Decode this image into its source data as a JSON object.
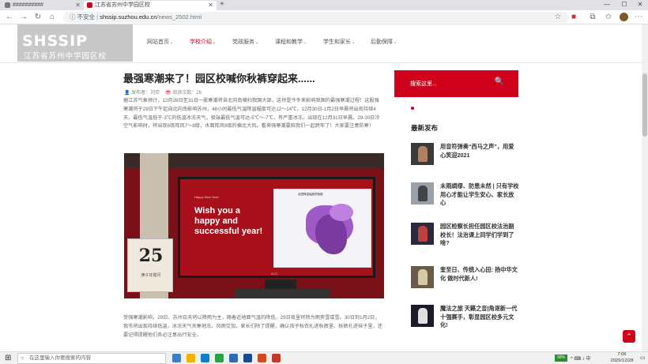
{
  "browser": {
    "tabs": [
      {
        "label": "##########"
      },
      {
        "label": "江苏省苏州中学园区校"
      }
    ],
    "new_tab": "+",
    "window_controls": {
      "minimize": "—",
      "maximize": "☐",
      "close": "✕"
    },
    "nav": {
      "back": "←",
      "forward": "→",
      "reload": "↻",
      "home": "⌂"
    },
    "address": {
      "security": "ⓘ 不安全",
      "host": "shssip.suzhou.edu.cn",
      "path": "/news_2502.html"
    },
    "toolbar_icons": {
      "star": "☆",
      "ext": "■",
      "collections": "⧉",
      "menu": "⋯"
    }
  },
  "site": {
    "logo_main": "SHSSIP",
    "logo_sub": "江苏省苏州中学园区校",
    "nav": [
      {
        "label": "网站首页",
        "chevron": "⌄"
      },
      {
        "label": "学校介绍",
        "chevron": "⌄"
      },
      {
        "label": "党政服务",
        "chevron": "⌄"
      },
      {
        "label": "课程和教学",
        "chevron": "⌄"
      },
      {
        "label": "学生和家长",
        "chevron": "⌄"
      },
      {
        "label": "后勤保障",
        "chevron": "⌄"
      }
    ]
  },
  "article": {
    "title": "最强寒潮来了！园区校喊你秋裤穿起来......",
    "author": "发布者：刘欢",
    "views": "阅读次数：26",
    "para1": "据江苏气象预计，12月28日至31日一股寒潮将自北向南横扫我国大部，这将是今冬来影响我国的最强寒潮过程！这股强寒潮将于29日下午起自北向南影响苏州，48小时最低气温降温幅度可达12～14℃，12月30日-1月2日早晨将出现持续4天、最低气温低于-3℃的低温冰冻天气，极端最低气温可达-5℃～-7℃，有严重冰冻。出现在12月31日早晨。29-30日冷空气影响时，将出现6级阵风7～8级，水面阵风9级的偏北大风。看来强寒潮要陪我们一起跨年了！大家要注意防寒！",
    "photo": {
      "tv_small": "Happy New Year!",
      "tv_text": "Wish you a happy and successful year!",
      "map_title": "全国降温幅度预报图",
      "calendar_day": "25",
      "calendar_sub": "庚子年腊月",
      "brand": "AOC"
    },
    "para2": "受强寒潮影响，29日、苏州日天将以降雨为主，随着近地面气温的降低，29日夜里将转为雨夹雪或雪。30日到1月2日，我市将出现持续低温，冰冻天气天寒地冻、风雨交加，家长们除了提醒，确认孩子秋衣扎进秋裤里、秋裤扎进袜子里，还要记得提醒他们务必注意出行安全。"
  },
  "sidebar": {
    "search_placeholder": "搜索这里...",
    "search_icon": "🔍",
    "latest_heading": "最新发布",
    "posts": [
      {
        "title": "用音符弹奏“西马之声”，用爱心笑迎2021"
      },
      {
        "title": "未雨绸缪、防患未然 | 只有学校用心才能让学生安心、家长放心"
      },
      {
        "title": "园区检察长担任园区校法治副校长！法治课上同学们学到了啥?"
      },
      {
        "title": "奎至日、传统入心田: 扬中华文化 做时代新人!"
      },
      {
        "title": "魔法之旅 天籁之音|角逐新一代十强赛手，彰显园区校多元文化!"
      }
    ],
    "fab_icon": "⌃"
  },
  "taskbar": {
    "start": "⊞",
    "search_placeholder": "在这里输入你要搜索的内容",
    "search_icon": "○",
    "battery": "99%",
    "tray": "^ ⌨ ♪ 中",
    "time": "7:06",
    "date": "2020/12/28",
    "notifications": "▭",
    "apps": [
      {
        "color": "#3c7dc4"
      },
      {
        "color": "#f2b200"
      },
      {
        "color": "#0f7fc4"
      },
      {
        "color": "#2aa24a"
      },
      {
        "color": "#2c6ab3"
      },
      {
        "color": "#1a4a8a"
      },
      {
        "color": "#d04a1b"
      },
      {
        "color": "#c0392b"
      }
    ]
  }
}
